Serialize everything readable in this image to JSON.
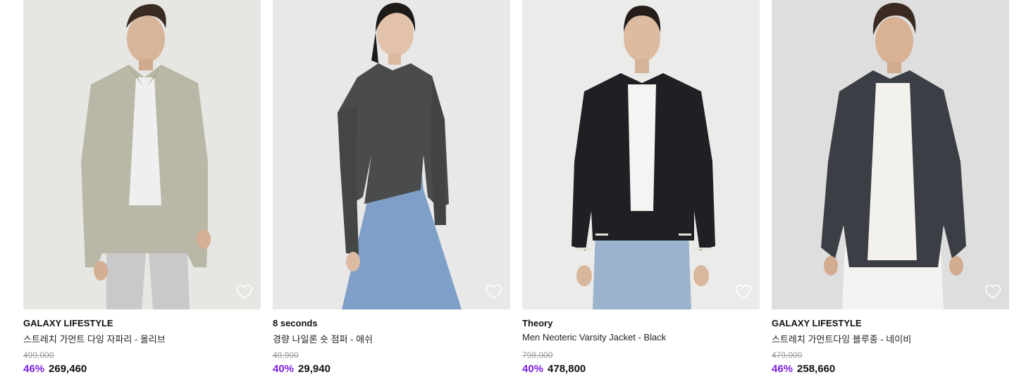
{
  "colors": {
    "discount": "#7b1fe0",
    "original_price": "#999999"
  },
  "products": [
    {
      "brand": "GALAXY LIFESTYLE",
      "name": "스트레치 가먼트 다잉 자파리 - 올리브",
      "original_price": "499,000",
      "discount": "46%",
      "price": "269,460",
      "wishlist_icon": "heart-outline-icon"
    },
    {
      "brand": "8 seconds",
      "name": "경량 나일론 숏 점퍼 - 애쉬",
      "original_price": "49,900",
      "discount": "40%",
      "price": "29,940",
      "wishlist_icon": "heart-outline-icon"
    },
    {
      "brand": "Theory",
      "name": "Men Neoteric Varsity Jacket - Black",
      "original_price": "798,000",
      "discount": "40%",
      "price": "478,800",
      "wishlist_icon": "heart-outline-icon"
    },
    {
      "brand": "GALAXY LIFESTYLE",
      "name": "스트레치 가먼트다잉 블루종 - 네이비",
      "original_price": "479,000",
      "discount": "46%",
      "price": "258,660",
      "wishlist_icon": "heart-outline-icon"
    }
  ]
}
